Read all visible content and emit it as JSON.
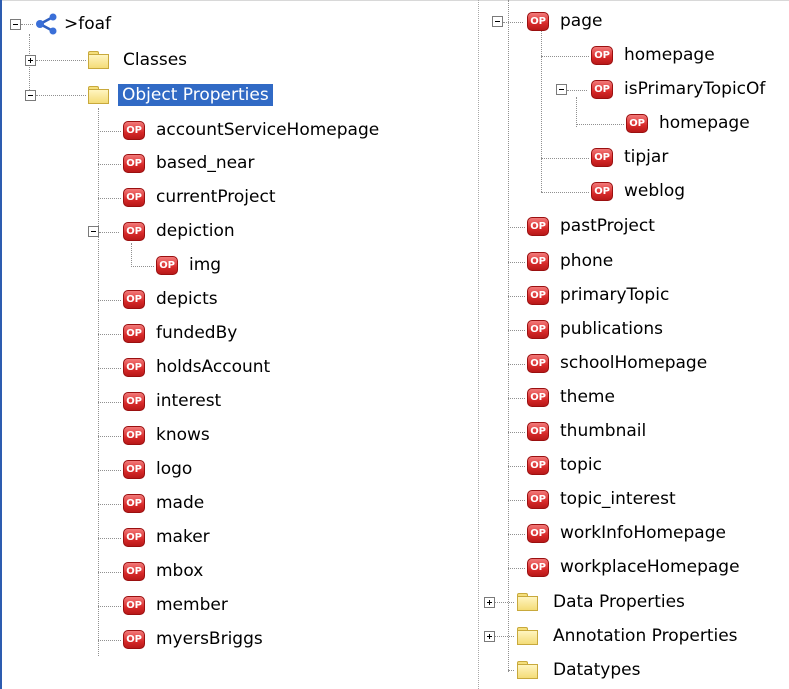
{
  "root": {
    "label": ">foaf",
    "icon": "ontology-network-icon"
  },
  "folders": {
    "classes": "Classes",
    "object_properties": "Object Properties",
    "data_properties": "Data Properties",
    "annotation_properties": "Annotation Properties",
    "datatypes": "Datatypes"
  },
  "op_badge": "OP",
  "left_items": [
    "accountServiceHomepage",
    "based_near",
    "currentProject",
    "depiction",
    "img",
    "depicts",
    "fundedBy",
    "holdsAccount",
    "interest",
    "knows",
    "logo",
    "made",
    "maker",
    "mbox",
    "member",
    "myersBriggs"
  ],
  "right_items": [
    "page",
    "homepage",
    "isPrimaryTopicOf",
    "homepage",
    "tipjar",
    "weblog",
    "pastProject",
    "phone",
    "primaryTopic",
    "publications",
    "schoolHomepage",
    "theme",
    "thumbnail",
    "topic",
    "topic_interest",
    "workInfoHomepage",
    "workplaceHomepage"
  ],
  "selected": "Object Properties"
}
